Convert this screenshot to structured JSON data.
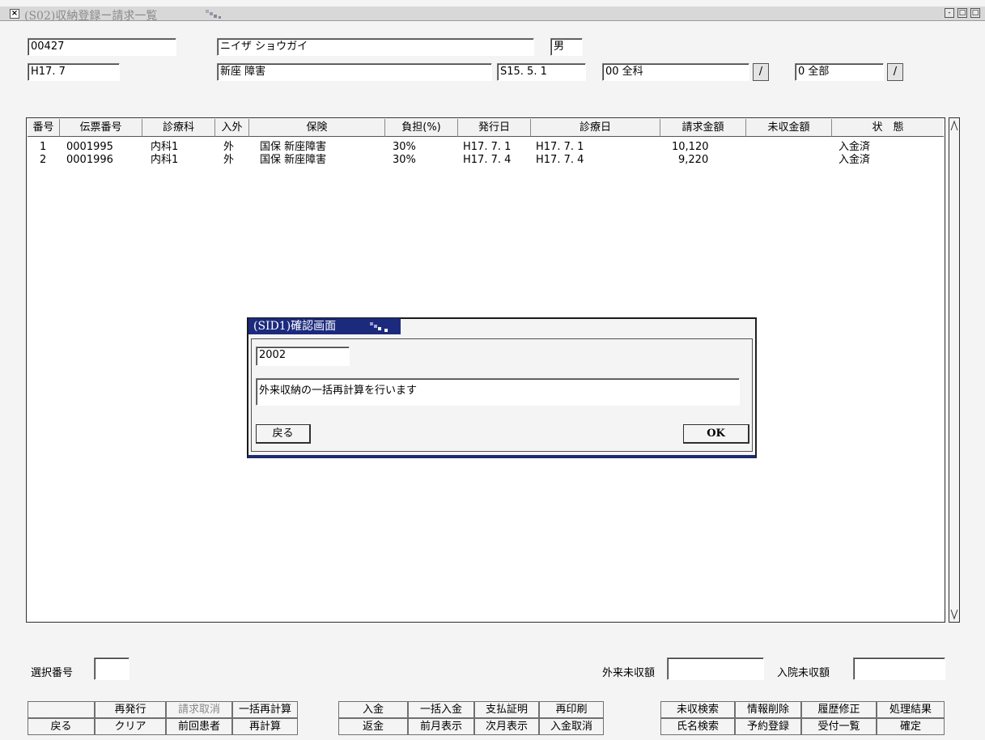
{
  "window": {
    "title": "(S02)収納登録ー請求一覧",
    "close_glyph": "×",
    "min_glyph": "-",
    "max_glyph": "□"
  },
  "header": {
    "patient_id": "00427",
    "kana_name": "ニイザ ショウガイ",
    "sex": "男",
    "period": "H17. 7",
    "kanji_name": "新座 障害",
    "birth_date": "S15. 5. 1",
    "department": "00 全科",
    "scope": "0 全部",
    "drop_glyph": "/"
  },
  "table": {
    "headers": [
      "番号",
      "伝票番号",
      "診療科",
      "入外",
      "保険",
      "負担(%)",
      "発行日",
      "診療日",
      "請求金額",
      "未収金額",
      "状　態"
    ],
    "rows": [
      [
        "1",
        "0001995",
        "内科1",
        "外",
        "国保 新座障害",
        "30%",
        "H17. 7. 1",
        "H17. 7. 1",
        "10,120",
        "",
        "入金済"
      ],
      [
        "2",
        "0001996",
        "内科1",
        "外",
        "国保 新座障害",
        "30%",
        "H17. 7. 4",
        "H17. 7. 4",
        "9,220",
        "",
        "入金済"
      ]
    ]
  },
  "footer": {
    "select_label": "選択番号",
    "select_value": "",
    "outpatient_label": "外来未収額",
    "outpatient_value": "",
    "inpatient_label": "入院未収額",
    "inpatient_value": ""
  },
  "fkeys_top": [
    "",
    "再発行",
    "請求取消",
    "一括再計算",
    "入金",
    "一括入金",
    "支払証明",
    "再印刷",
    "未収検索",
    "情報削除",
    "履歴修正",
    "処理結果"
  ],
  "fkeys_bottom": [
    "戻る",
    "クリア",
    "前回患者",
    "再計算",
    "返金",
    "前月表示",
    "次月表示",
    "入金取消",
    "氏名検索",
    "予約登録",
    "受付一覧",
    "確定"
  ],
  "dialog": {
    "title": "(SID1)確認画面",
    "code": "2002",
    "message": "外来収納の一括再計算を行います",
    "back_label": "戻る",
    "ok_label": "OK"
  },
  "colors": {
    "dialog_title_bg": "#1c2a7e",
    "disabled_text": "#8a8a8a"
  }
}
